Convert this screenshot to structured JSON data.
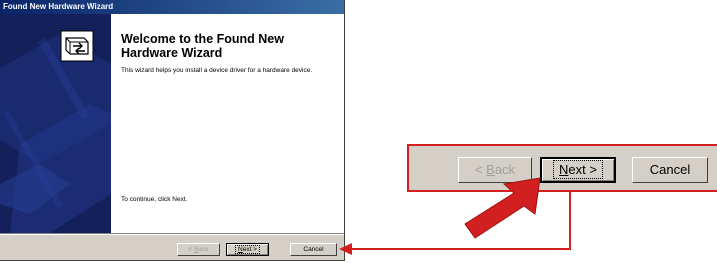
{
  "wizard": {
    "title": "Found New Hardware Wizard",
    "heading": "Welcome to the Found New Hardware Wizard",
    "description": "This wizard helps you install a device driver for a hardware device.",
    "continue_text": "To continue, click Next.",
    "buttons": {
      "back": {
        "prefix": "< ",
        "key": "B",
        "rest": "ack",
        "enabled": false
      },
      "next": {
        "key": "N",
        "rest": "ext >",
        "default": true
      },
      "cancel": {
        "label": "Cancel"
      }
    }
  },
  "zoom": {
    "buttons": {
      "back": {
        "prefix": "< ",
        "key": "B",
        "rest": "ack",
        "enabled": false
      },
      "next": {
        "key": "N",
        "rest": "ext >",
        "default": true
      },
      "cancel": {
        "label": "Cancel"
      }
    }
  },
  "colors": {
    "titlebar": "#0a246a",
    "sidebar": "#13205a",
    "callout": "#d22020",
    "face": "#d4d0c8"
  },
  "icons": [
    "hardware-box-icon",
    "pointer-arrow-icon",
    "connector-arrow-icon"
  ]
}
